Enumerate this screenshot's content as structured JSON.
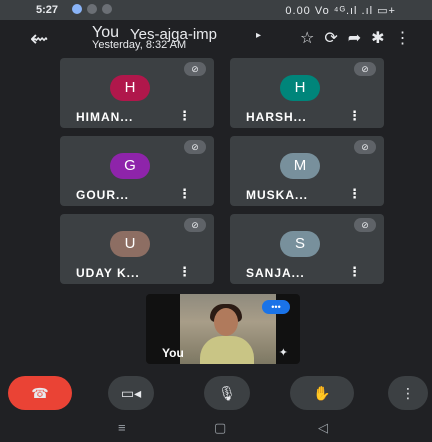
{
  "status_bar": {
    "time": "5:27",
    "right_text": "0.00 Vo ⁴ᴳ.ıl .ıl ▭+"
  },
  "header": {
    "back_icon": "arrow-left-icon",
    "title_you": "You",
    "title_name": "Yes-ajga-imp",
    "subtitle": "Yesterday, 8:32 AM",
    "caret": "▸",
    "icons": [
      "star-outline-icon",
      "rotate-camera-icon",
      "share-arrow-icon",
      "bluetooth-icon",
      "more-vertical-icon"
    ]
  },
  "participants": [
    {
      "name": "HIMAN...",
      "initial": "H",
      "color": "#b0174b",
      "muted_icon": "mic-off-icon"
    },
    {
      "name": "HARSH...",
      "initial": "H",
      "color": "#00857a",
      "muted_icon": "mic-off-icon"
    },
    {
      "name": "GOUR...",
      "initial": "G",
      "color": "#8e24aa",
      "muted_icon": "mic-off-icon"
    },
    {
      "name": "MUSKA...",
      "initial": "M",
      "color": "#78909c",
      "muted_icon": "mic-off-icon"
    },
    {
      "name": "UDAY K...",
      "initial": "U",
      "color": "#8d6e63",
      "muted_icon": "mic-off-icon"
    },
    {
      "name": "SANJA...",
      "initial": "S",
      "color": "#78909c",
      "muted_icon": "mic-off-icon"
    }
  ],
  "self_view": {
    "label": "You",
    "speaking_icon": "audio-level-icon",
    "effects_icon": "visual-effects-icon"
  },
  "controls": {
    "end_call": {
      "icon": "hang-up-icon",
      "color": "#ea4335"
    },
    "camera": {
      "icon": "camera-icon"
    },
    "mic": {
      "icon": "microphone-icon"
    },
    "raise_hand": {
      "icon": "raise-hand-icon"
    },
    "more": {
      "icon": "more-vertical-icon"
    }
  },
  "nav_bar": {
    "recents": "recents-icon",
    "home": "home-icon",
    "back": "back-icon"
  }
}
